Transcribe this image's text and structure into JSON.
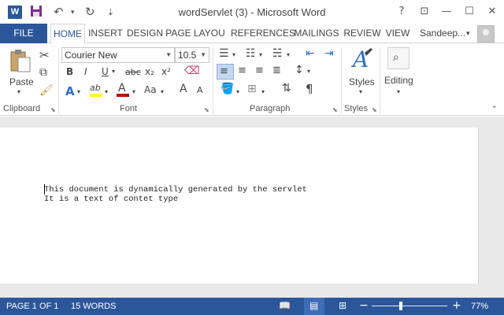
{
  "window": {
    "title": "wordServlet (3) - Microsoft Word",
    "help": "?",
    "ribbon_display": "⊡",
    "minimize": "—",
    "maximize": "☐",
    "close": "✕"
  },
  "qat": {
    "logo": "W",
    "save_icon": "💾",
    "undo_icon": "↶",
    "undo_dd": "▾",
    "redo_icon": "↻",
    "customize_icon": "⇣"
  },
  "tabs": {
    "file": "FILE",
    "items": [
      "HOME",
      "INSERT",
      "DESIGN",
      "PAGE LAYOU",
      "REFERENCES",
      "MAILINGS",
      "REVIEW",
      "VIEW"
    ],
    "active": "HOME",
    "user": "Sandeep...",
    "user_dd": "▾"
  },
  "ribbon": {
    "clipboard": {
      "label": "Clipboard",
      "paste": "Paste",
      "paste_dd": "▾"
    },
    "font": {
      "label": "Font",
      "font_name": "Courier New",
      "font_size": "10.5",
      "grow": "A",
      "shrink": "A",
      "case": "Aa",
      "bold": "B",
      "italic": "I",
      "underline": "U",
      "strike": "abc",
      "subscript": "x₂",
      "superscript": "x²",
      "text_effects": "A",
      "highlight": "ab",
      "font_color": "A",
      "highlight_color": "#ffff00",
      "font_color_bar": "#c00000"
    },
    "paragraph": {
      "label": "Paragraph",
      "show_marks": "¶"
    },
    "styles": {
      "label": "Styles",
      "button": "Styles"
    },
    "editing": {
      "button": "Editing"
    }
  },
  "document": {
    "lines": [
      "This document is dynamically generated by the servlet",
      "It is a text of contet type"
    ]
  },
  "status": {
    "page": "PAGE 1 OF 1",
    "words": "15 WORDS",
    "zoom_minus": "−",
    "zoom_plus": "+",
    "zoom": "77%"
  },
  "colors": {
    "accent": "#2b579a"
  }
}
